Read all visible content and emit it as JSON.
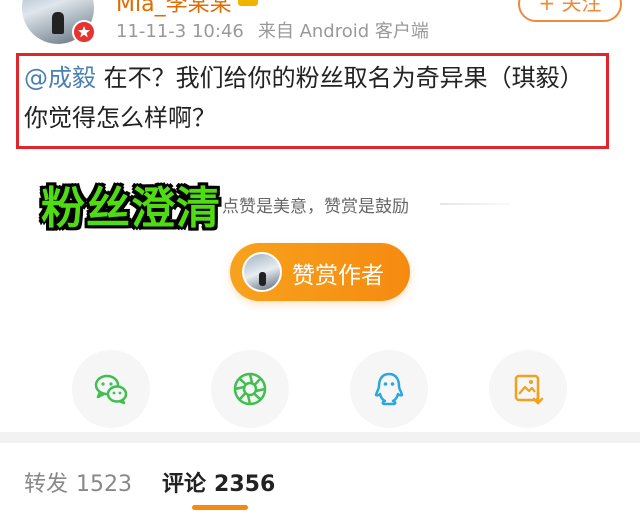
{
  "header": {
    "username": "Mia_李某某",
    "timestamp": "11-11-3 10:46",
    "source": "来自 Android 客户端",
    "follow_label": "+ 关注"
  },
  "post": {
    "mention": "@成毅",
    "text": " 在不？我们给你的粉丝取名为奇异果（琪毅）你觉得怎么样啊？"
  },
  "overlay_caption": "粉丝澄清",
  "reward": {
    "caption": "点赞是美意，赞赏是鼓励",
    "button_label": "赞赏作者"
  },
  "share_icons": [
    "wechat-icon",
    "moments-icon",
    "qq-icon",
    "save-image-icon"
  ],
  "colors": {
    "accent": "#f68a10",
    "mention": "#4a7fb5",
    "highlight_box": "#e0262d",
    "overlay_text": "#4fdc12",
    "wechat": "#3fbf4f",
    "qq": "#2aa7e0"
  },
  "tabs": {
    "repost_label": "转发",
    "repost_count": "1523",
    "comment_label": "评论",
    "comment_count": "2356"
  }
}
